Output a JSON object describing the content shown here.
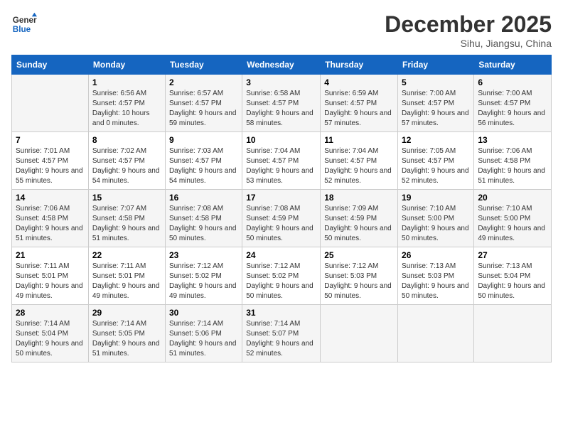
{
  "header": {
    "logo_line1": "General",
    "logo_line2": "Blue",
    "month": "December 2025",
    "location": "Sihu, Jiangsu, China"
  },
  "weekdays": [
    "Sunday",
    "Monday",
    "Tuesday",
    "Wednesday",
    "Thursday",
    "Friday",
    "Saturday"
  ],
  "weeks": [
    [
      {
        "day": "",
        "sunrise": "",
        "sunset": "",
        "daylight": ""
      },
      {
        "day": "1",
        "sunrise": "Sunrise: 6:56 AM",
        "sunset": "Sunset: 4:57 PM",
        "daylight": "Daylight: 10 hours and 0 minutes."
      },
      {
        "day": "2",
        "sunrise": "Sunrise: 6:57 AM",
        "sunset": "Sunset: 4:57 PM",
        "daylight": "Daylight: 9 hours and 59 minutes."
      },
      {
        "day": "3",
        "sunrise": "Sunrise: 6:58 AM",
        "sunset": "Sunset: 4:57 PM",
        "daylight": "Daylight: 9 hours and 58 minutes."
      },
      {
        "day": "4",
        "sunrise": "Sunrise: 6:59 AM",
        "sunset": "Sunset: 4:57 PM",
        "daylight": "Daylight: 9 hours and 57 minutes."
      },
      {
        "day": "5",
        "sunrise": "Sunrise: 7:00 AM",
        "sunset": "Sunset: 4:57 PM",
        "daylight": "Daylight: 9 hours and 57 minutes."
      },
      {
        "day": "6",
        "sunrise": "Sunrise: 7:00 AM",
        "sunset": "Sunset: 4:57 PM",
        "daylight": "Daylight: 9 hours and 56 minutes."
      }
    ],
    [
      {
        "day": "7",
        "sunrise": "Sunrise: 7:01 AM",
        "sunset": "Sunset: 4:57 PM",
        "daylight": "Daylight: 9 hours and 55 minutes."
      },
      {
        "day": "8",
        "sunrise": "Sunrise: 7:02 AM",
        "sunset": "Sunset: 4:57 PM",
        "daylight": "Daylight: 9 hours and 54 minutes."
      },
      {
        "day": "9",
        "sunrise": "Sunrise: 7:03 AM",
        "sunset": "Sunset: 4:57 PM",
        "daylight": "Daylight: 9 hours and 54 minutes."
      },
      {
        "day": "10",
        "sunrise": "Sunrise: 7:04 AM",
        "sunset": "Sunset: 4:57 PM",
        "daylight": "Daylight: 9 hours and 53 minutes."
      },
      {
        "day": "11",
        "sunrise": "Sunrise: 7:04 AM",
        "sunset": "Sunset: 4:57 PM",
        "daylight": "Daylight: 9 hours and 52 minutes."
      },
      {
        "day": "12",
        "sunrise": "Sunrise: 7:05 AM",
        "sunset": "Sunset: 4:57 PM",
        "daylight": "Daylight: 9 hours and 52 minutes."
      },
      {
        "day": "13",
        "sunrise": "Sunrise: 7:06 AM",
        "sunset": "Sunset: 4:58 PM",
        "daylight": "Daylight: 9 hours and 51 minutes."
      }
    ],
    [
      {
        "day": "14",
        "sunrise": "Sunrise: 7:06 AM",
        "sunset": "Sunset: 4:58 PM",
        "daylight": "Daylight: 9 hours and 51 minutes."
      },
      {
        "day": "15",
        "sunrise": "Sunrise: 7:07 AM",
        "sunset": "Sunset: 4:58 PM",
        "daylight": "Daylight: 9 hours and 51 minutes."
      },
      {
        "day": "16",
        "sunrise": "Sunrise: 7:08 AM",
        "sunset": "Sunset: 4:58 PM",
        "daylight": "Daylight: 9 hours and 50 minutes."
      },
      {
        "day": "17",
        "sunrise": "Sunrise: 7:08 AM",
        "sunset": "Sunset: 4:59 PM",
        "daylight": "Daylight: 9 hours and 50 minutes."
      },
      {
        "day": "18",
        "sunrise": "Sunrise: 7:09 AM",
        "sunset": "Sunset: 4:59 PM",
        "daylight": "Daylight: 9 hours and 50 minutes."
      },
      {
        "day": "19",
        "sunrise": "Sunrise: 7:10 AM",
        "sunset": "Sunset: 5:00 PM",
        "daylight": "Daylight: 9 hours and 50 minutes."
      },
      {
        "day": "20",
        "sunrise": "Sunrise: 7:10 AM",
        "sunset": "Sunset: 5:00 PM",
        "daylight": "Daylight: 9 hours and 49 minutes."
      }
    ],
    [
      {
        "day": "21",
        "sunrise": "Sunrise: 7:11 AM",
        "sunset": "Sunset: 5:01 PM",
        "daylight": "Daylight: 9 hours and 49 minutes."
      },
      {
        "day": "22",
        "sunrise": "Sunrise: 7:11 AM",
        "sunset": "Sunset: 5:01 PM",
        "daylight": "Daylight: 9 hours and 49 minutes."
      },
      {
        "day": "23",
        "sunrise": "Sunrise: 7:12 AM",
        "sunset": "Sunset: 5:02 PM",
        "daylight": "Daylight: 9 hours and 49 minutes."
      },
      {
        "day": "24",
        "sunrise": "Sunrise: 7:12 AM",
        "sunset": "Sunset: 5:02 PM",
        "daylight": "Daylight: 9 hours and 50 minutes."
      },
      {
        "day": "25",
        "sunrise": "Sunrise: 7:12 AM",
        "sunset": "Sunset: 5:03 PM",
        "daylight": "Daylight: 9 hours and 50 minutes."
      },
      {
        "day": "26",
        "sunrise": "Sunrise: 7:13 AM",
        "sunset": "Sunset: 5:03 PM",
        "daylight": "Daylight: 9 hours and 50 minutes."
      },
      {
        "day": "27",
        "sunrise": "Sunrise: 7:13 AM",
        "sunset": "Sunset: 5:04 PM",
        "daylight": "Daylight: 9 hours and 50 minutes."
      }
    ],
    [
      {
        "day": "28",
        "sunrise": "Sunrise: 7:14 AM",
        "sunset": "Sunset: 5:04 PM",
        "daylight": "Daylight: 9 hours and 50 minutes."
      },
      {
        "day": "29",
        "sunrise": "Sunrise: 7:14 AM",
        "sunset": "Sunset: 5:05 PM",
        "daylight": "Daylight: 9 hours and 51 minutes."
      },
      {
        "day": "30",
        "sunrise": "Sunrise: 7:14 AM",
        "sunset": "Sunset: 5:06 PM",
        "daylight": "Daylight: 9 hours and 51 minutes."
      },
      {
        "day": "31",
        "sunrise": "Sunrise: 7:14 AM",
        "sunset": "Sunset: 5:07 PM",
        "daylight": "Daylight: 9 hours and 52 minutes."
      },
      {
        "day": "",
        "sunrise": "",
        "sunset": "",
        "daylight": ""
      },
      {
        "day": "",
        "sunrise": "",
        "sunset": "",
        "daylight": ""
      },
      {
        "day": "",
        "sunrise": "",
        "sunset": "",
        "daylight": ""
      }
    ]
  ]
}
